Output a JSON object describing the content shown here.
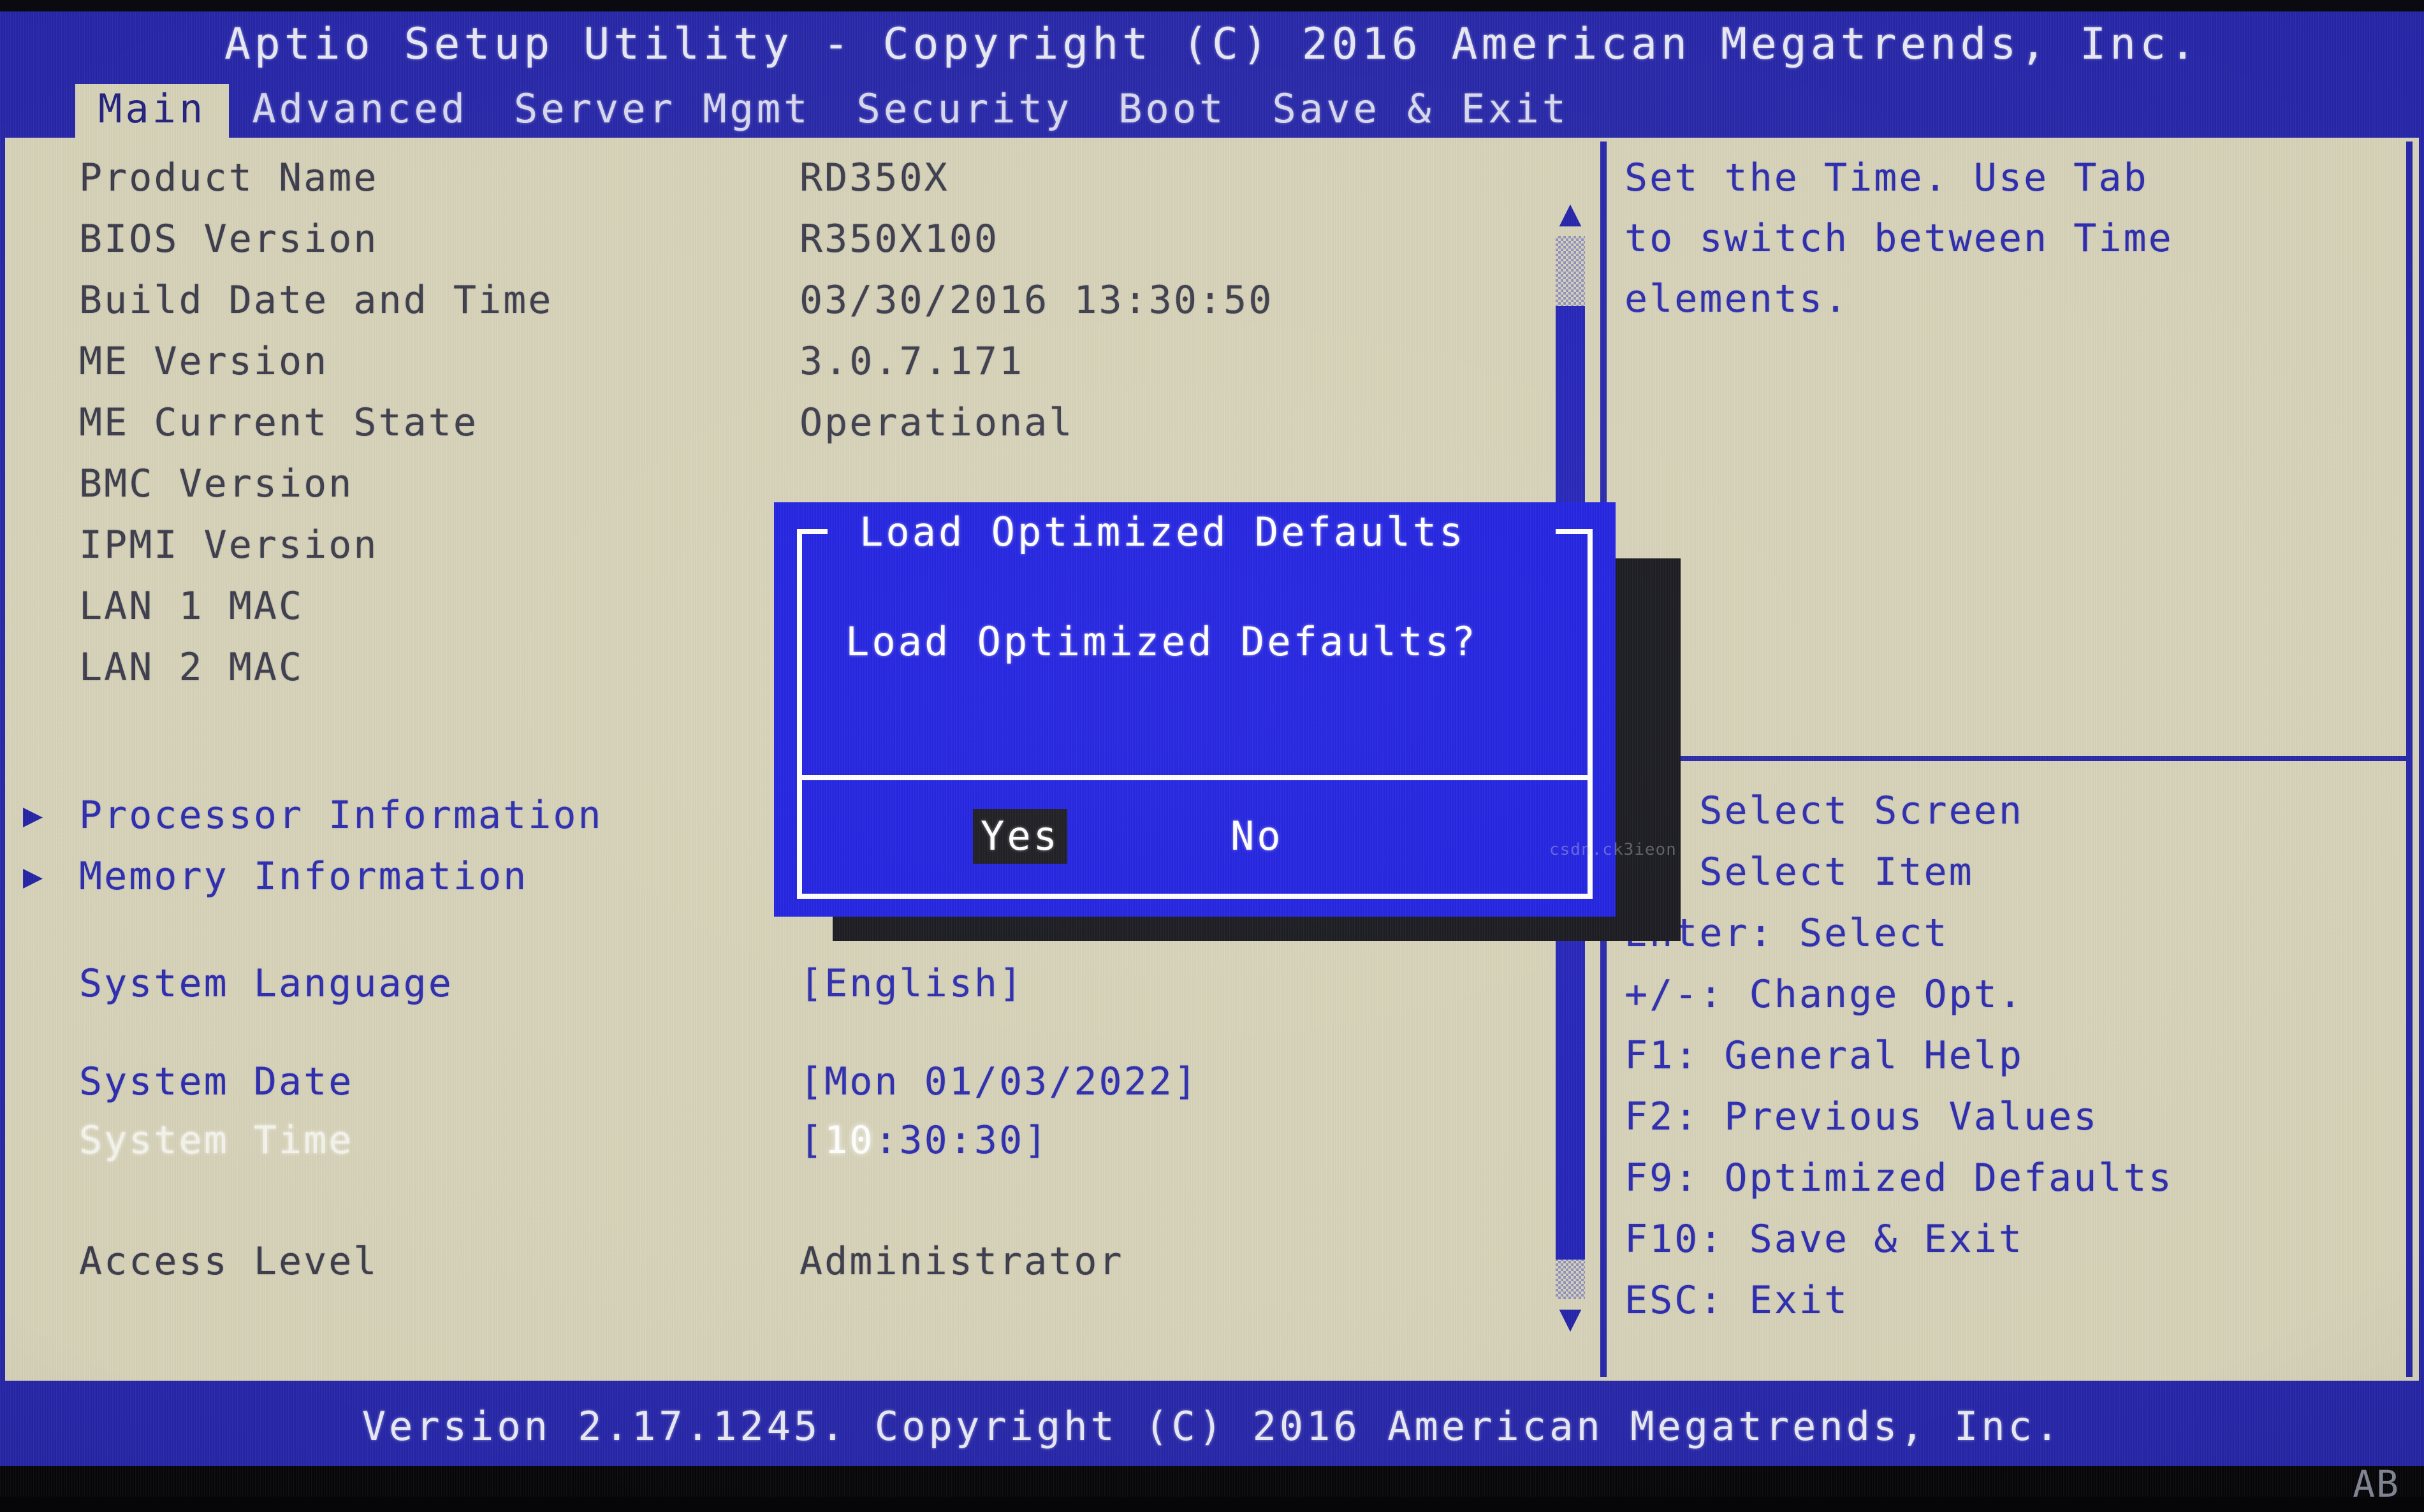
{
  "header": {
    "title": "Aptio Setup Utility - Copyright (C) 2016 American Megatrends, Inc."
  },
  "tabs": [
    {
      "label": "Main",
      "active": true
    },
    {
      "label": "Advanced",
      "active": false
    },
    {
      "label": "Server Mgmt",
      "active": false
    },
    {
      "label": "Security",
      "active": false
    },
    {
      "label": "Boot",
      "active": false
    },
    {
      "label": "Save & Exit",
      "active": false
    }
  ],
  "main": {
    "rows": [
      {
        "arrow": "",
        "label": "Product Name",
        "value": "RD350X",
        "style": "dark"
      },
      {
        "arrow": "",
        "label": "BIOS Version",
        "value": "R350X100",
        "style": "dark"
      },
      {
        "arrow": "",
        "label": "Build Date and Time",
        "value": "03/30/2016 13:30:50",
        "style": "dark"
      },
      {
        "arrow": "",
        "label": "ME Version",
        "value": "3.0.7.171",
        "style": "dark"
      },
      {
        "arrow": "",
        "label": "ME Current State",
        "value": "Operational",
        "style": "dark"
      },
      {
        "arrow": "",
        "label": "BMC Version",
        "value": "",
        "style": "dark"
      },
      {
        "arrow": "",
        "label": "IPMI Version",
        "value": "",
        "style": "dark"
      },
      {
        "arrow": "",
        "label": "LAN 1 MAC",
        "value": "",
        "style": "dark"
      },
      {
        "arrow": "",
        "label": "LAN 2 MAC",
        "value": "",
        "style": "dark"
      },
      {
        "arrow": "▶",
        "label": "Processor Information",
        "value": "",
        "style": "blue"
      },
      {
        "arrow": "▶",
        "label": "Memory Information",
        "value": "",
        "style": "blue"
      },
      {
        "arrow": "",
        "label": "System Language",
        "value": "[English]",
        "style": "blue"
      },
      {
        "arrow": "",
        "label": "System Date",
        "value": "[Mon 01/03/2022]",
        "style": "blue"
      },
      {
        "arrow": "",
        "label": "System Time",
        "value": "[10:30:30]",
        "style": "selected"
      },
      {
        "arrow": "",
        "label": "Access Level",
        "value": "Administrator",
        "style": "dark"
      }
    ],
    "time_cursor_digits": "10"
  },
  "scrollbar": {
    "up_arrow": "▲",
    "down_arrow": "▼"
  },
  "help": {
    "lines": [
      "Set the Time. Use Tab",
      "to switch between Time",
      "elements."
    ]
  },
  "keys": [
    "↔: Select Screen",
    "↕: Select Item",
    "Enter: Select",
    "+/-: Change Opt.",
    "F1: General Help",
    "F2: Previous Values",
    "F9: Optimized Defaults",
    "F10: Save & Exit",
    "ESC: Exit"
  ],
  "dialog": {
    "title": "Load Optimized Defaults",
    "question": "Load Optimized Defaults?",
    "yes_label": "Yes",
    "no_label": "No",
    "selected": "Yes"
  },
  "footer": {
    "text": "Version 2.17.1245. Copyright (C) 2016 American Megatrends, Inc."
  },
  "watermark": {
    "bottom_right": "AB",
    "mid_right": "csdn.ck3ieon"
  },
  "colors": {
    "bios_blue": "#2626a8",
    "panel_beige": "#d6d2b8",
    "dialog_blue": "#1e1ee0",
    "text_blue": "#2a2aae",
    "text_dark": "#3a3a4a",
    "highlight_white": "#f4f4ec",
    "selected_bg": "#17171d"
  }
}
